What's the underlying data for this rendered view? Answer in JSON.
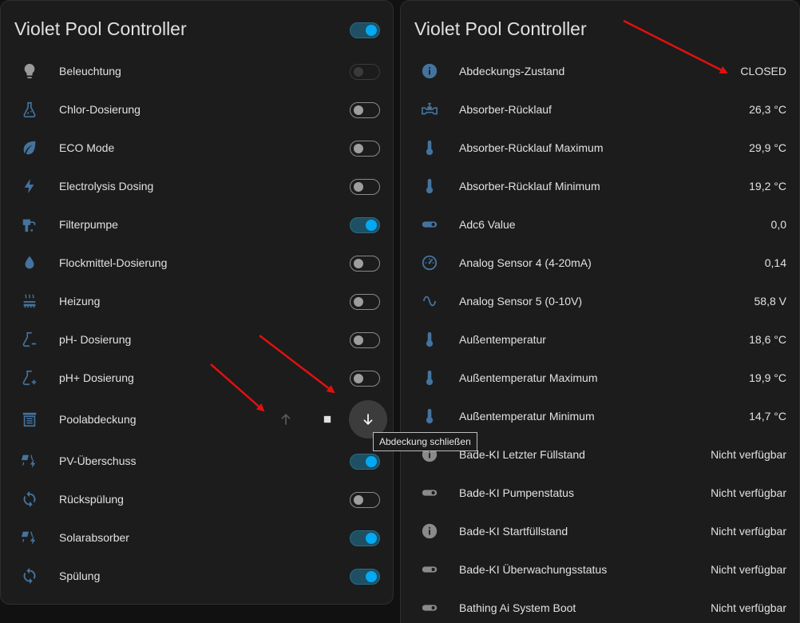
{
  "colors": {
    "icon": "#44739e",
    "toggle_on": "#03a9f4",
    "arrow": "#e01010"
  },
  "left_card": {
    "title": "Violet Pool Controller",
    "header_toggle_on": true,
    "rows": [
      {
        "label": "Beleuchtung",
        "icon": "lightbulb-icon",
        "state": "disabled"
      },
      {
        "label": "Chlor-Dosierung",
        "icon": "flask-icon",
        "state": "off"
      },
      {
        "label": "ECO Mode",
        "icon": "leaf-icon",
        "state": "off"
      },
      {
        "label": "Electrolysis Dosing",
        "icon": "flash-icon",
        "state": "off"
      },
      {
        "label": "Filterpumpe",
        "icon": "pump-icon",
        "state": "on"
      },
      {
        "label": "Flockmittel-Dosierung",
        "icon": "water-drop-icon",
        "state": "off"
      },
      {
        "label": "Heizung",
        "icon": "radiator-icon",
        "state": "off"
      },
      {
        "label": "pH- Dosierung",
        "icon": "beaker-minus-icon",
        "state": "off"
      },
      {
        "label": "pH+ Dosierung",
        "icon": "beaker-plus-icon",
        "state": "off"
      },
      {
        "label": "Poolabdeckung",
        "icon": "pool-cover-icon",
        "state": "cover"
      },
      {
        "label": "PV-Überschuss",
        "icon": "solar-power-icon",
        "state": "on"
      },
      {
        "label": "Rückspülung",
        "icon": "sync-icon",
        "state": "off"
      },
      {
        "label": "Solarabsorber",
        "icon": "solar-power-icon",
        "state": "on"
      },
      {
        "label": "Spülung",
        "icon": "sync-icon",
        "state": "on"
      }
    ],
    "tooltip": "Abdeckung schließen"
  },
  "right_card": {
    "title": "Violet Pool Controller",
    "rows": [
      {
        "label": "Abdeckungs-Zustand",
        "value": "CLOSED",
        "icon": "info-icon"
      },
      {
        "label": "Absorber-Rücklauf",
        "value": "26,3 °C",
        "icon": "valve-icon"
      },
      {
        "label": "Absorber-Rücklauf Maximum",
        "value": "29,9 °C",
        "icon": "thermometer-icon"
      },
      {
        "label": "Absorber-Rücklauf Minimum",
        "value": "19,2 °C",
        "icon": "thermometer-icon"
      },
      {
        "label": "Adc6 Value",
        "value": "0,0",
        "icon": "toggle-switch-icon"
      },
      {
        "label": "Analog Sensor 4 (4-20mA)",
        "value": "0,14",
        "icon": "gauge-icon"
      },
      {
        "label": "Analog Sensor 5 (0-10V)",
        "value": "58,8 V",
        "icon": "sine-wave-icon"
      },
      {
        "label": "Außentemperatur",
        "value": "18,6 °C",
        "icon": "thermometer-icon"
      },
      {
        "label": "Außentemperatur Maximum",
        "value": "19,9 °C",
        "icon": "thermometer-icon"
      },
      {
        "label": "Außentemperatur Minimum",
        "value": "14,7 °C",
        "icon": "thermometer-icon"
      },
      {
        "label": "Bade-KI Letzter Füllstand",
        "value": "Nicht verfügbar",
        "icon": "info-icon",
        "unavailable": true
      },
      {
        "label": "Bade-KI Pumpenstatus",
        "value": "Nicht verfügbar",
        "icon": "toggle-switch-icon",
        "unavailable": true
      },
      {
        "label": "Bade-KI Startfüllstand",
        "value": "Nicht verfügbar",
        "icon": "info-icon",
        "unavailable": true
      },
      {
        "label": "Bade-KI Überwachungsstatus",
        "value": "Nicht verfügbar",
        "icon": "toggle-switch-icon",
        "unavailable": true
      },
      {
        "label": "Bathing Ai System Boot",
        "value": "Nicht verfügbar",
        "icon": "toggle-switch-icon",
        "unavailable": true
      }
    ]
  }
}
